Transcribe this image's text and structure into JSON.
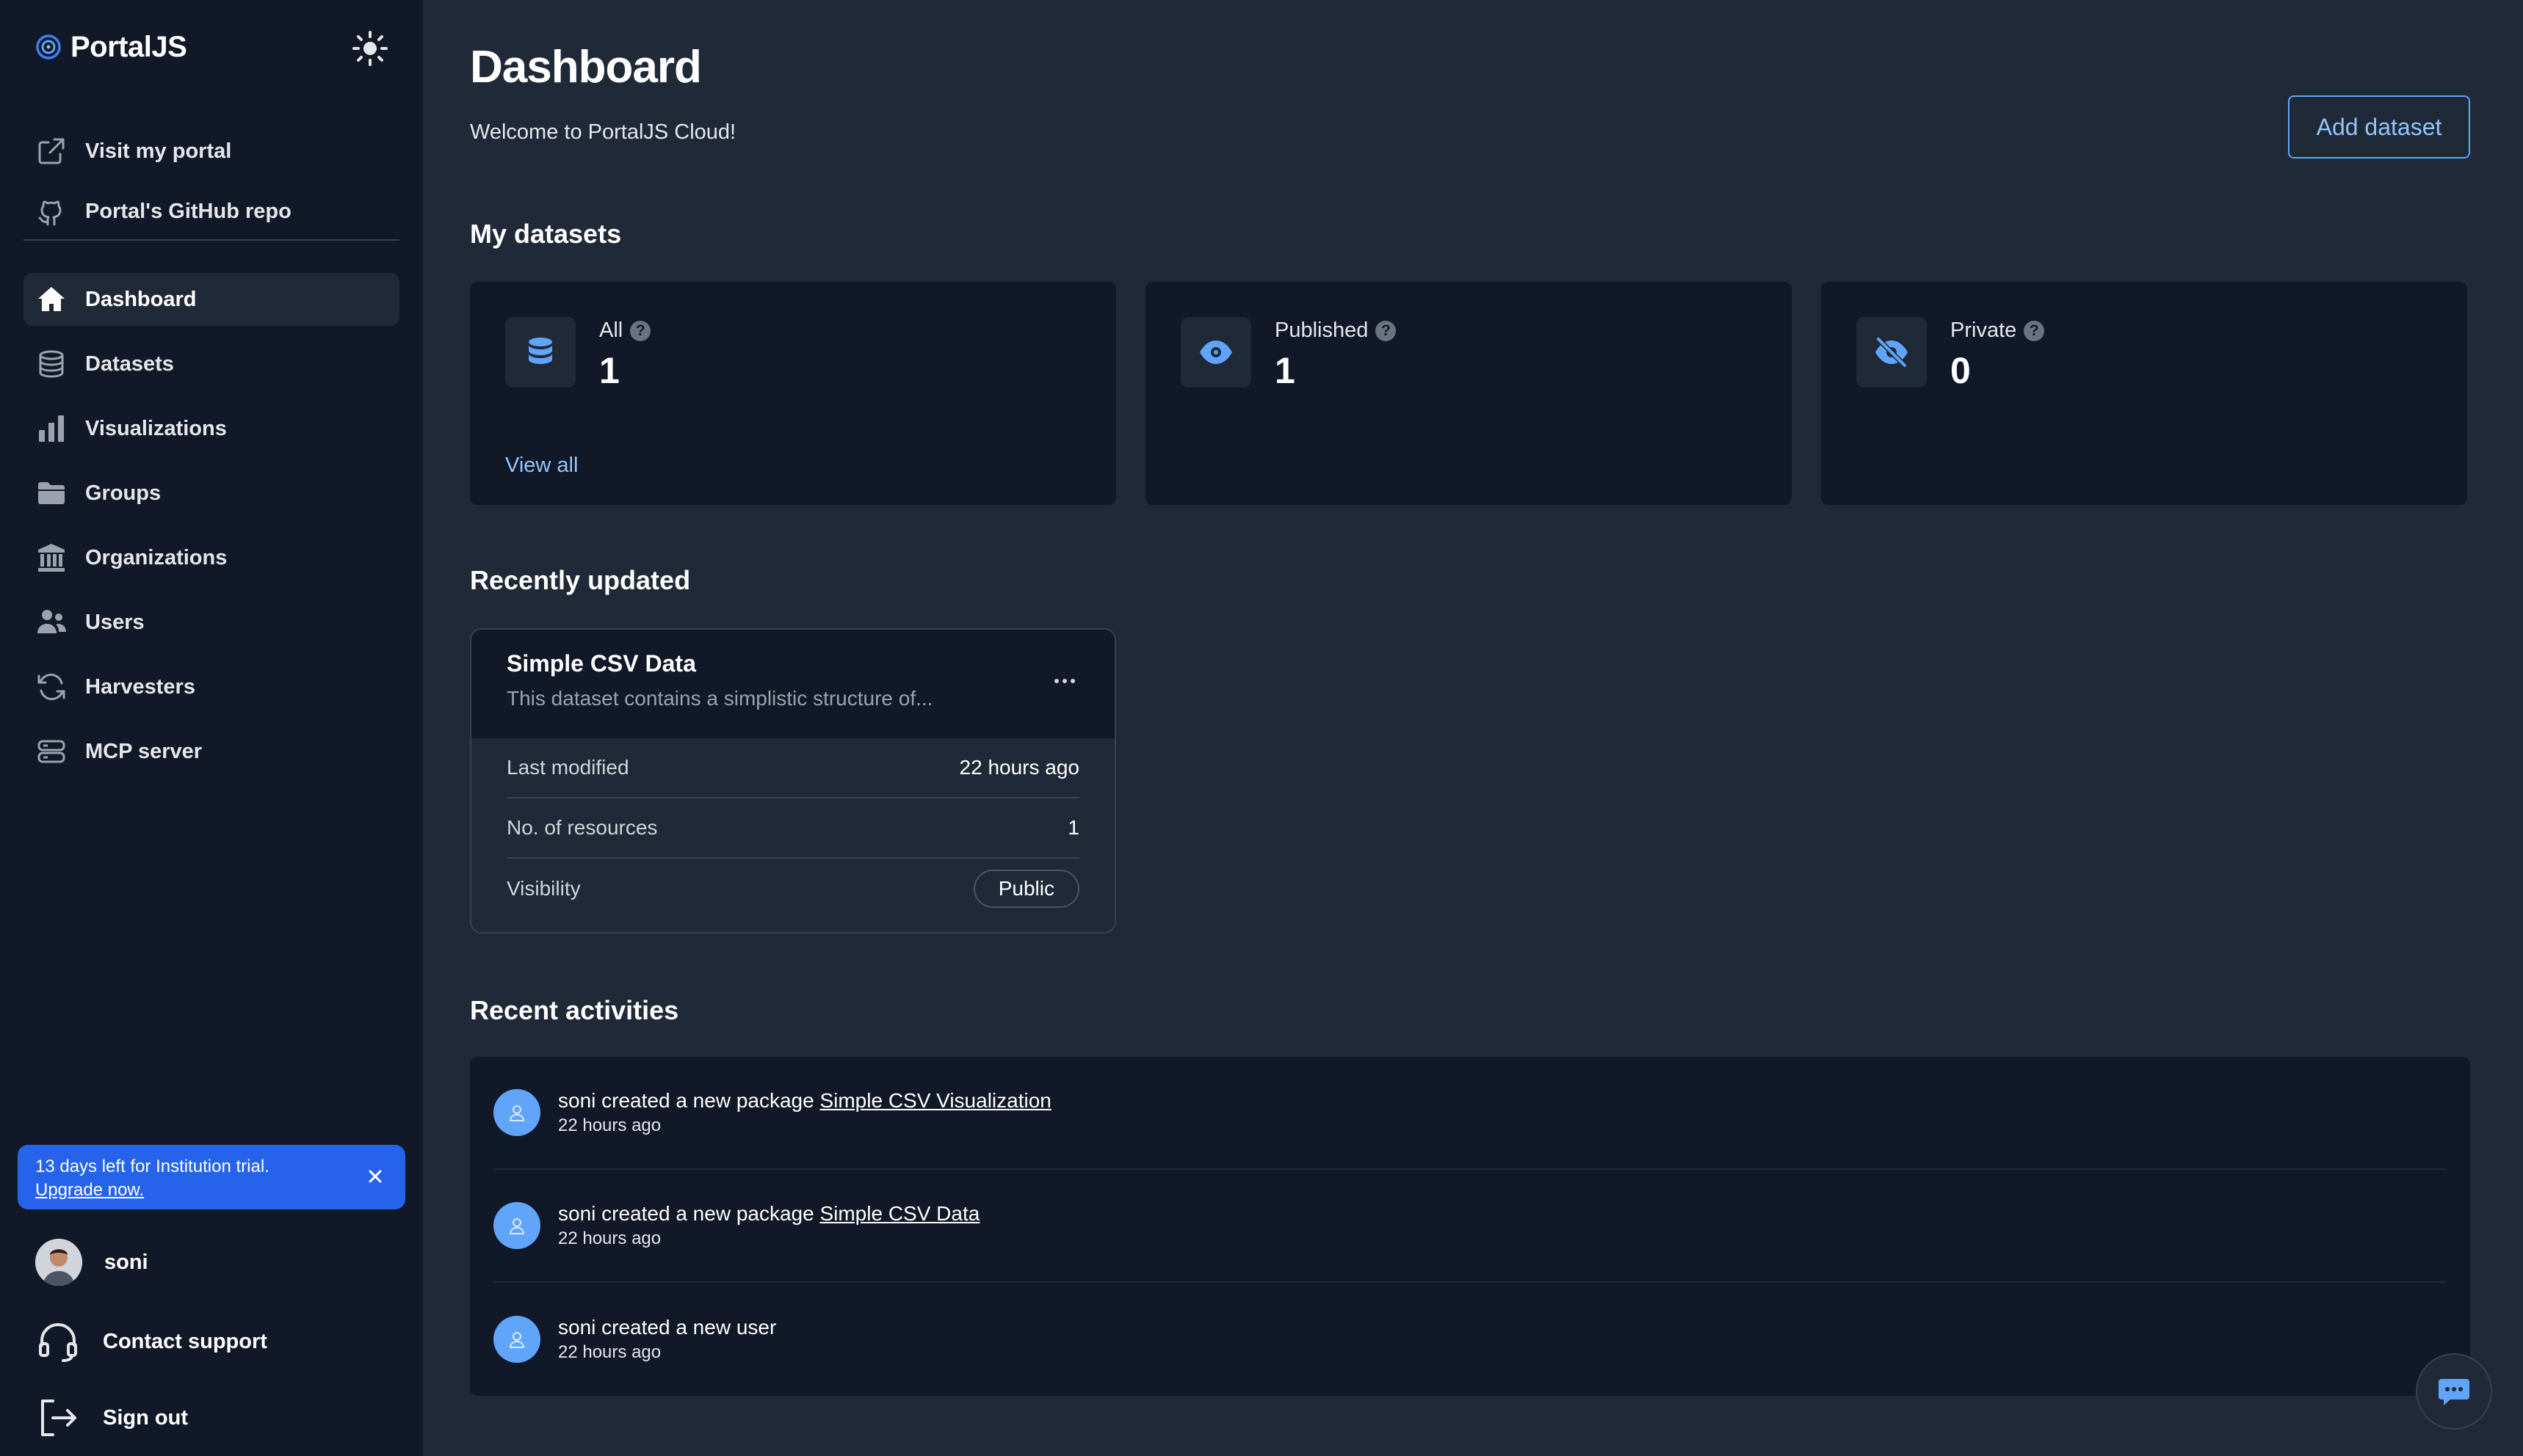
{
  "brand": {
    "name": "PortalJS"
  },
  "sidebar": {
    "top_links": [
      {
        "label": "Visit my portal",
        "icon": "external-link-icon"
      },
      {
        "label": "Portal's GitHub repo",
        "icon": "github-icon"
      }
    ],
    "nav": [
      {
        "label": "Dashboard",
        "icon": "home-icon",
        "active": true
      },
      {
        "label": "Datasets",
        "icon": "database-icon"
      },
      {
        "label": "Visualizations",
        "icon": "bar-chart-icon"
      },
      {
        "label": "Groups",
        "icon": "folder-icon"
      },
      {
        "label": "Organizations",
        "icon": "building-icon"
      },
      {
        "label": "Users",
        "icon": "users-icon"
      },
      {
        "label": "Harvesters",
        "icon": "refresh-icon"
      },
      {
        "label": "MCP server",
        "icon": "server-icon"
      }
    ],
    "trial": {
      "text": "13 days left for Institution trial.",
      "link": "Upgrade now."
    },
    "user": {
      "name": "soni"
    },
    "support_label": "Contact support",
    "signout_label": "Sign out"
  },
  "header": {
    "title": "Dashboard",
    "subtitle": "Welcome to PortalJS Cloud!",
    "add_label": "Add dataset"
  },
  "datasets": {
    "title": "My datasets",
    "cards": [
      {
        "label": "All",
        "value": "1",
        "icon": "database-icon",
        "link": "View all"
      },
      {
        "label": "Published",
        "value": "1",
        "icon": "eye-icon"
      },
      {
        "label": "Private",
        "value": "0",
        "icon": "eye-slash-icon"
      }
    ]
  },
  "recent": {
    "title": "Recently updated",
    "item": {
      "title": "Simple CSV Data",
      "desc": "This dataset contains a simplistic structure of...",
      "rows": [
        {
          "label": "Last modified",
          "value": "22 hours ago"
        },
        {
          "label": "No. of resources",
          "value": "1"
        },
        {
          "label": "Visibility",
          "value": "Public"
        }
      ]
    }
  },
  "activities": {
    "title": "Recent activities",
    "items": [
      {
        "text": "soni created a new package ",
        "link": "Simple CSV Visualization",
        "time": "22 hours ago"
      },
      {
        "text": "soni created a new package ",
        "link": "Simple CSV Data",
        "time": "22 hours ago"
      },
      {
        "text": "soni created a new user",
        "link": "",
        "time": "22 hours ago"
      }
    ]
  },
  "colors": {
    "accent": "#60a5fa",
    "sidebar_bg": "#111827",
    "main_bg": "#1f2937",
    "banner": "#2563eb"
  }
}
